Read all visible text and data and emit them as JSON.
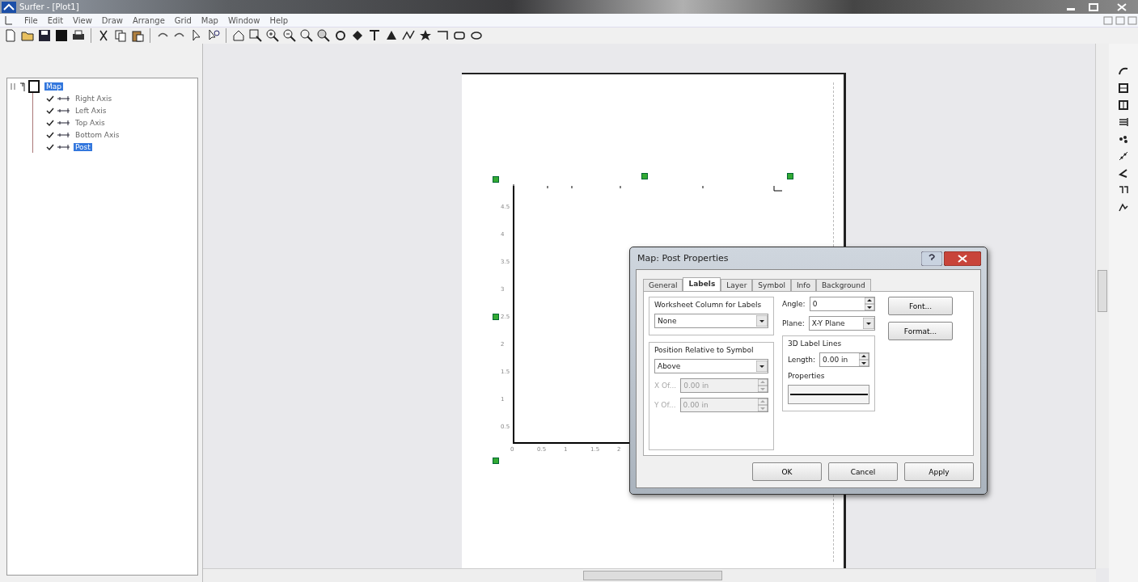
{
  "window": {
    "title": "Surfer - [Plot1]"
  },
  "menu": [
    "File",
    "Edit",
    "View",
    "Draw",
    "Arrange",
    "Grid",
    "Map",
    "Window",
    "Help"
  ],
  "object_tree": [
    {
      "label": "Map",
      "selected": true,
      "children": [
        {
          "label": "Right Axis",
          "checked": true,
          "selected": false
        },
        {
          "label": "Left Axis",
          "checked": true,
          "selected": false
        },
        {
          "label": "Top Axis",
          "checked": true,
          "selected": false
        },
        {
          "label": "Bottom Axis",
          "checked": true,
          "selected": false
        },
        {
          "label": "Post",
          "checked": true,
          "selected": true
        }
      ]
    }
  ],
  "plot": {
    "left_axis_labels": [
      "4.5",
      "4",
      "3.5",
      "3",
      "2.5",
      "2",
      "1.5",
      "1",
      "0.5"
    ],
    "bottom_axis_labels": [
      "0",
      "0.5",
      "1",
      "1.5",
      "2"
    ]
  },
  "dialog": {
    "title": "Map: Post Properties",
    "tabs": [
      {
        "label": "General",
        "selected": false
      },
      {
        "label": "Labels",
        "selected": true
      },
      {
        "label": "Layer",
        "selected": false
      },
      {
        "label": "Symbol",
        "selected": false
      },
      {
        "label": "Info",
        "selected": false
      },
      {
        "label": "Background",
        "selected": false
      }
    ],
    "worksheet_group": {
      "title": "Worksheet Column for Labels",
      "value": "None"
    },
    "position_group": {
      "title": "Position Relative to Symbol",
      "value": "Above",
      "offsets": [
        {
          "label": "X Of...",
          "value": "0.00 in",
          "disabled": true
        },
        {
          "label": "Y Of...",
          "value": "0.00 in",
          "disabled": true
        }
      ]
    },
    "angle": {
      "label": "Angle:",
      "value": "0"
    },
    "plane": {
      "label": "Plane:",
      "value": "X-Y Plane"
    },
    "label_lines": {
      "title": "3D Label Lines",
      "length_label": "Length:",
      "length_value": "0.00 in",
      "properties_label": "Properties"
    },
    "side_buttons": [
      "Font...",
      "Format..."
    ],
    "buttons": [
      "OK",
      "Cancel",
      "Apply"
    ]
  }
}
